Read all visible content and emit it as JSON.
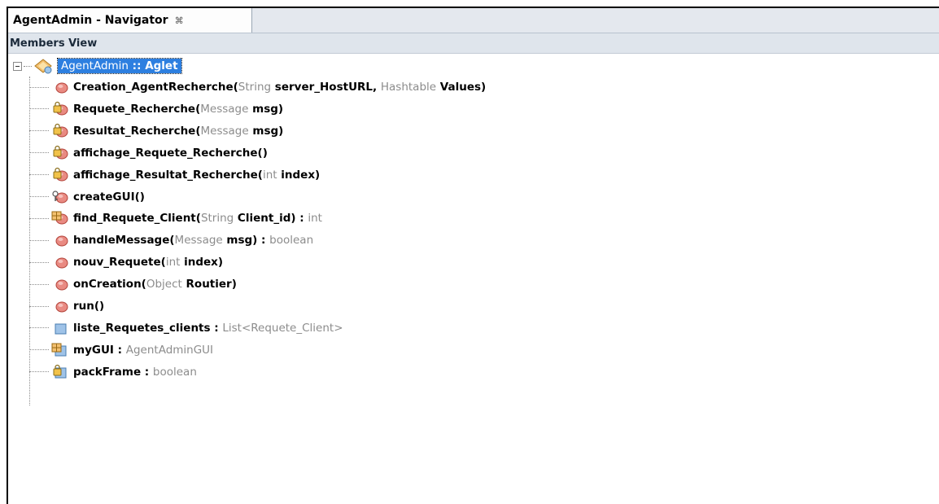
{
  "window": {
    "tab_title": "AgentAdmin - Navigator",
    "tab_close": "⌘",
    "toolbar_label": "Members View"
  },
  "tree": {
    "root": {
      "name": "AgentAdmin",
      "sep": " :: ",
      "type": "Aglet",
      "icon": "class-icon"
    },
    "members": [
      {
        "icon": "public-method-icon",
        "parts": [
          {
            "s": "b",
            "t": "Creation_AgentRecherche("
          },
          {
            "s": "t",
            "t": "String"
          },
          {
            "s": "b",
            "t": " server_HostURL, "
          },
          {
            "s": "t",
            "t": "Hashtable"
          },
          {
            "s": "b",
            "t": " Values)"
          }
        ]
      },
      {
        "icon": "protected-method-icon",
        "parts": [
          {
            "s": "b",
            "t": "Requete_Recherche("
          },
          {
            "s": "t",
            "t": "Message"
          },
          {
            "s": "b",
            "t": " msg)"
          }
        ]
      },
      {
        "icon": "protected-method-icon",
        "parts": [
          {
            "s": "b",
            "t": "Resultat_Recherche("
          },
          {
            "s": "t",
            "t": "Message"
          },
          {
            "s": "b",
            "t": " msg)"
          }
        ]
      },
      {
        "icon": "protected-method-icon",
        "parts": [
          {
            "s": "b",
            "t": "affichage_Requete_Recherche()"
          }
        ]
      },
      {
        "icon": "protected-method-icon",
        "parts": [
          {
            "s": "b",
            "t": "affichage_Resultat_Recherche("
          },
          {
            "s": "t",
            "t": "int"
          },
          {
            "s": "b",
            "t": " index)"
          }
        ]
      },
      {
        "icon": "private-method-icon",
        "parts": [
          {
            "s": "b",
            "t": "createGUI()"
          }
        ]
      },
      {
        "icon": "package-method-icon",
        "parts": [
          {
            "s": "b",
            "t": "find_Requete_Client("
          },
          {
            "s": "t",
            "t": "String"
          },
          {
            "s": "b",
            "t": " Client_id) : "
          },
          {
            "s": "t",
            "t": "int"
          }
        ]
      },
      {
        "icon": "public-method-icon",
        "parts": [
          {
            "s": "b",
            "t": "handleMessage("
          },
          {
            "s": "t",
            "t": "Message"
          },
          {
            "s": "b",
            "t": " msg) : "
          },
          {
            "s": "t",
            "t": "boolean"
          }
        ]
      },
      {
        "icon": "public-method-icon",
        "parts": [
          {
            "s": "b",
            "t": "nouv_Requete("
          },
          {
            "s": "t",
            "t": "int"
          },
          {
            "s": "b",
            "t": " index)"
          }
        ]
      },
      {
        "icon": "public-method-icon",
        "parts": [
          {
            "s": "b",
            "t": "onCreation("
          },
          {
            "s": "t",
            "t": "Object"
          },
          {
            "s": "b",
            "t": " Routier)"
          }
        ]
      },
      {
        "icon": "public-method-icon",
        "parts": [
          {
            "s": "b",
            "t": "run()"
          }
        ]
      },
      {
        "icon": "field-icon",
        "parts": [
          {
            "s": "b",
            "t": "liste_Requetes_clients : "
          },
          {
            "s": "t",
            "t": "List<Requete_Client>"
          }
        ]
      },
      {
        "icon": "package-field-icon",
        "parts": [
          {
            "s": "b",
            "t": "myGUI : "
          },
          {
            "s": "t",
            "t": "AgentAdminGUI"
          }
        ]
      },
      {
        "icon": "protected-field-icon",
        "parts": [
          {
            "s": "b",
            "t": "packFrame : "
          },
          {
            "s": "t",
            "t": "boolean"
          }
        ]
      }
    ]
  },
  "colors": {
    "selection": "#2d7fe0",
    "type_gray": "#8c8c8c",
    "method_red": "#e05a4f",
    "field_blue": "#9fc3e8"
  }
}
